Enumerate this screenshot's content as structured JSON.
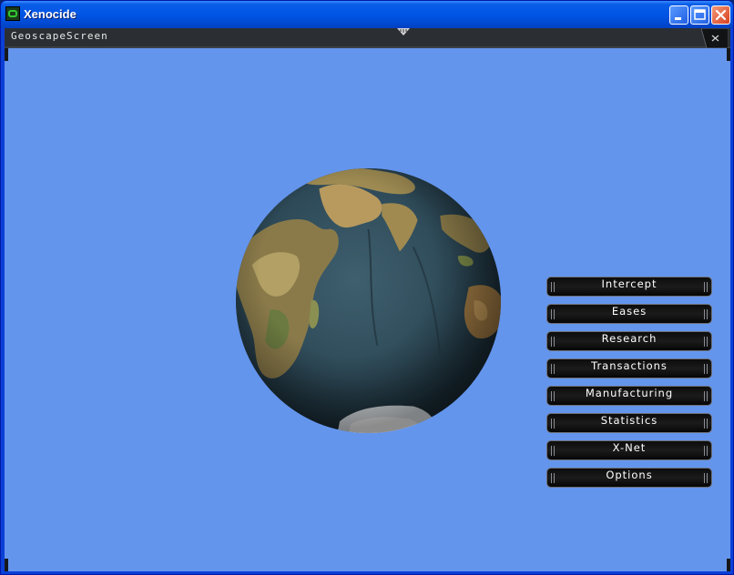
{
  "window": {
    "title": "Xenocide",
    "colors": {
      "titlebar": "#0055e5",
      "client_background": "#6495ed",
      "panel_bar": "#2b2f33"
    }
  },
  "geoscape": {
    "title": "GeoscapeScreen",
    "globe_icon": "earth-globe-icon",
    "menu": [
      {
        "label": "Intercept"
      },
      {
        "label": "Eases"
      },
      {
        "label": "Research"
      },
      {
        "label": "Transactions"
      },
      {
        "label": "Manufacturing"
      },
      {
        "label": "Statistics"
      },
      {
        "label": "X-Net"
      },
      {
        "label": "Options"
      }
    ]
  }
}
